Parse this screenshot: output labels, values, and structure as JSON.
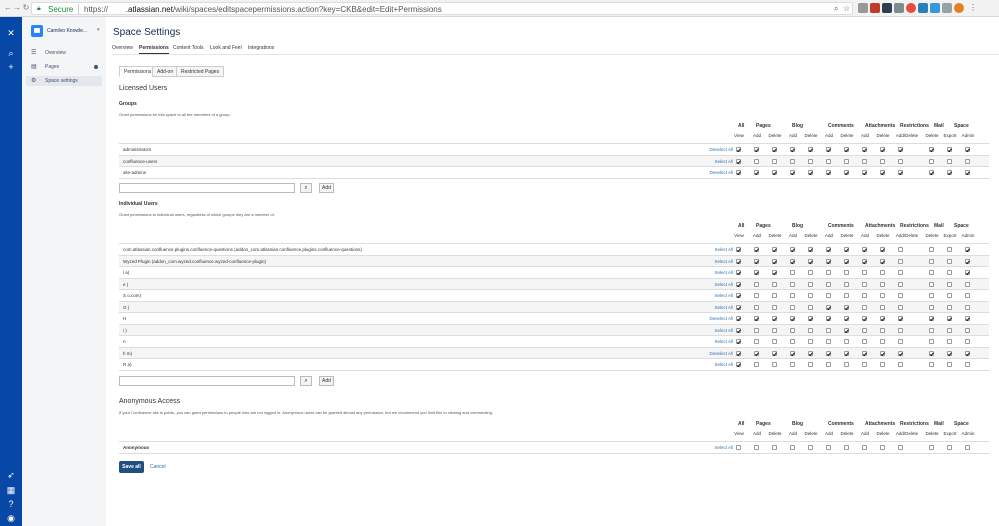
{
  "browser": {
    "secure_label": "Secure",
    "url_prefix": "https://",
    "url_host": ".atlassian.net",
    "url_path": "/wiki/spaces/editspacepermissions.action?key=CKB&edit=Edit+Permissions"
  },
  "sidebar": {
    "space_name": "Camilvo Knowle...",
    "items": [
      {
        "label": "Overview",
        "icon": "list-icon"
      },
      {
        "label": "Pages",
        "icon": "pages-icon"
      },
      {
        "label": "Space settings",
        "icon": "gear-icon"
      }
    ]
  },
  "header": {
    "title": "Space Settings"
  },
  "tabs": [
    "Overview",
    "Permissions",
    "Content Tools",
    "Look and Feel",
    "Integrations"
  ],
  "subtabs": [
    "Permissions",
    "Add-on",
    "Restricted Pages"
  ],
  "licensed_heading": "Licensed Users",
  "column_groups": [
    "All",
    "Pages",
    "Blog",
    "Comments",
    "Attachments",
    "Restrictions",
    "Mail",
    "Space"
  ],
  "columns": [
    "View",
    "Add",
    "Delete",
    "Add",
    "Delete",
    "Add",
    "Delete",
    "Add",
    "Delete",
    "Add/Delete",
    "Delete",
    "Export",
    "Admin"
  ],
  "groups": {
    "heading": "Groups",
    "description": "Grant permissions for this space to all the members of a group.",
    "rows": [
      {
        "name": "administrators",
        "action": "Deselect All",
        "perms": [
          1,
          1,
          1,
          1,
          1,
          1,
          1,
          1,
          1,
          1,
          1,
          1,
          1
        ]
      },
      {
        "name": "confluence-users",
        "action": "Select All",
        "perms": [
          1,
          0,
          0,
          0,
          0,
          0,
          0,
          0,
          0,
          0,
          0,
          0,
          0
        ]
      },
      {
        "name": "site-admins",
        "action": "Deselect All",
        "perms": [
          1,
          1,
          1,
          1,
          1,
          1,
          1,
          1,
          1,
          1,
          1,
          1,
          1
        ]
      }
    ]
  },
  "individuals": {
    "heading": "Individual Users",
    "description": "Grant permissions to individual users, regardless of which groups they are a member of.",
    "rows": [
      {
        "name": "com.atlassian.confluence.plugins.confluence-questions (addon_com.atlassian.confluence.plugins.confluence-questions)",
        "action": "Select All",
        "perms": [
          1,
          1,
          1,
          1,
          1,
          1,
          1,
          1,
          1,
          0,
          0,
          0,
          1
        ]
      },
      {
        "name": "Wyzed Plugin (addon_com.wyzed.confluence.wyzed-confluence-plugin)",
        "action": "Select All",
        "perms": [
          1,
          1,
          1,
          1,
          1,
          1,
          1,
          1,
          1,
          0,
          0,
          0,
          1
        ]
      },
      {
        "name": "l               a)",
        "action": "Select All",
        "perms": [
          1,
          1,
          1,
          0,
          0,
          0,
          0,
          0,
          0,
          0,
          0,
          0,
          1
        ]
      },
      {
        "name": "e               )",
        "action": "Select All",
        "perms": [
          1,
          0,
          0,
          0,
          0,
          0,
          0,
          0,
          0,
          0,
          0,
          0,
          0
        ]
      },
      {
        "name": "S                          o.com)",
        "action": "Select All",
        "perms": [
          1,
          0,
          0,
          0,
          0,
          0,
          0,
          0,
          0,
          0,
          0,
          0,
          0
        ]
      },
      {
        "name": "G               )",
        "action": "Select All",
        "perms": [
          1,
          0,
          0,
          0,
          0,
          1,
          1,
          0,
          0,
          0,
          0,
          0,
          0
        ]
      },
      {
        "name": "H",
        "action": "Deselect All",
        "perms": [
          1,
          1,
          1,
          1,
          1,
          1,
          1,
          1,
          1,
          1,
          1,
          1,
          1
        ]
      },
      {
        "name": "i               )",
        "action": "Select All",
        "perms": [
          1,
          0,
          0,
          0,
          0,
          0,
          1,
          0,
          0,
          0,
          0,
          0,
          0
        ]
      },
      {
        "name": "n",
        "action": "Select All",
        "perms": [
          1,
          0,
          0,
          0,
          0,
          0,
          0,
          0,
          0,
          0,
          0,
          0,
          0
        ]
      },
      {
        "name": "h                    m)",
        "action": "Deselect All",
        "perms": [
          1,
          1,
          1,
          1,
          1,
          1,
          1,
          1,
          1,
          1,
          1,
          1,
          1
        ]
      },
      {
        "name": "R                 a)",
        "action": "Select All",
        "perms": [
          1,
          0,
          0,
          0,
          0,
          0,
          0,
          0,
          0,
          0,
          0,
          0,
          0
        ]
      }
    ]
  },
  "anonymous": {
    "heading": "Anonymous Access",
    "description": "If your Confluence site is public, you can grant permissions to people who are not logged in. Anonymous users can be granted almost any permission, but we recommend you limit this to viewing and commenting.",
    "rows": [
      {
        "name": "Anonymous",
        "action": "Select All",
        "perms": [
          0,
          0,
          0,
          0,
          0,
          0,
          0,
          0,
          0,
          0,
          0,
          0,
          0
        ]
      }
    ]
  },
  "add_button": "Add",
  "save_button": "Save all",
  "cancel_link": "Cancel"
}
